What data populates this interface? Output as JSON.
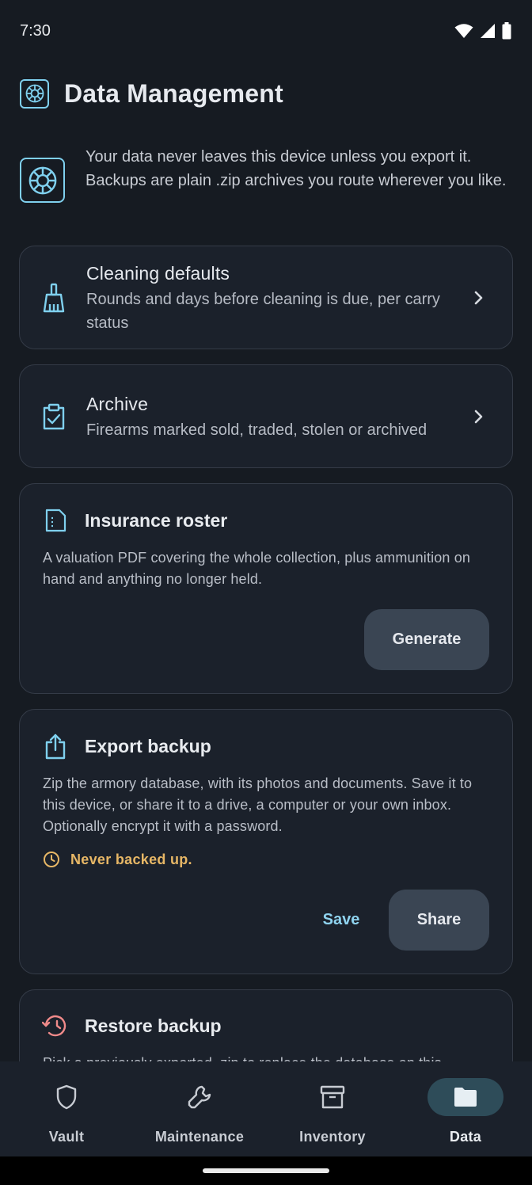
{
  "status_bar": {
    "time": "7:30"
  },
  "header": {
    "title": "Data Management",
    "icon": "settings-wheel-icon"
  },
  "intro": {
    "icon": "settings-wheel-icon",
    "text": "Your data never leaves this device unless you export it. Backups are plain .zip archives you route wherever you like."
  },
  "cleaning": {
    "icon": "broom-icon",
    "title": "Cleaning defaults",
    "subtitle": "Rounds and days before cleaning is due, per carry status"
  },
  "archive": {
    "icon": "clipboard-check-icon",
    "title": "Archive",
    "subtitle": "Firearms marked sold, traded, stolen or archived"
  },
  "insurance": {
    "icon": "document-icon",
    "title": "Insurance roster",
    "description": "A valuation PDF covering the whole collection, plus ammunition on hand and anything no longer held.",
    "generate_label": "Generate"
  },
  "export": {
    "icon": "share-upload-icon",
    "title": "Export backup",
    "description": "Zip the armory database, with its photos and documents. Save it to this device, or share it to a drive, a computer or your own inbox. Optionally encrypt it with a password.",
    "status": "Never backed up.",
    "save_label": "Save",
    "share_label": "Share"
  },
  "restore": {
    "icon": "restore-icon",
    "title": "Restore backup",
    "description": "Pick a previously exported .zip to replace the database on this device."
  },
  "bottom_nav": {
    "items": [
      {
        "label": "Vault",
        "icon": "shield-icon"
      },
      {
        "label": "Maintenance",
        "icon": "wrench-icon"
      },
      {
        "label": "Inventory",
        "icon": "archive-box-icon"
      },
      {
        "label": "Data",
        "icon": "folder-icon",
        "active": true
      }
    ]
  },
  "colors": {
    "background": "#161b22",
    "card": "#1b212b",
    "accent": "#7fd0ee",
    "warning": "#e7b766",
    "danger": "#f08a8a"
  }
}
